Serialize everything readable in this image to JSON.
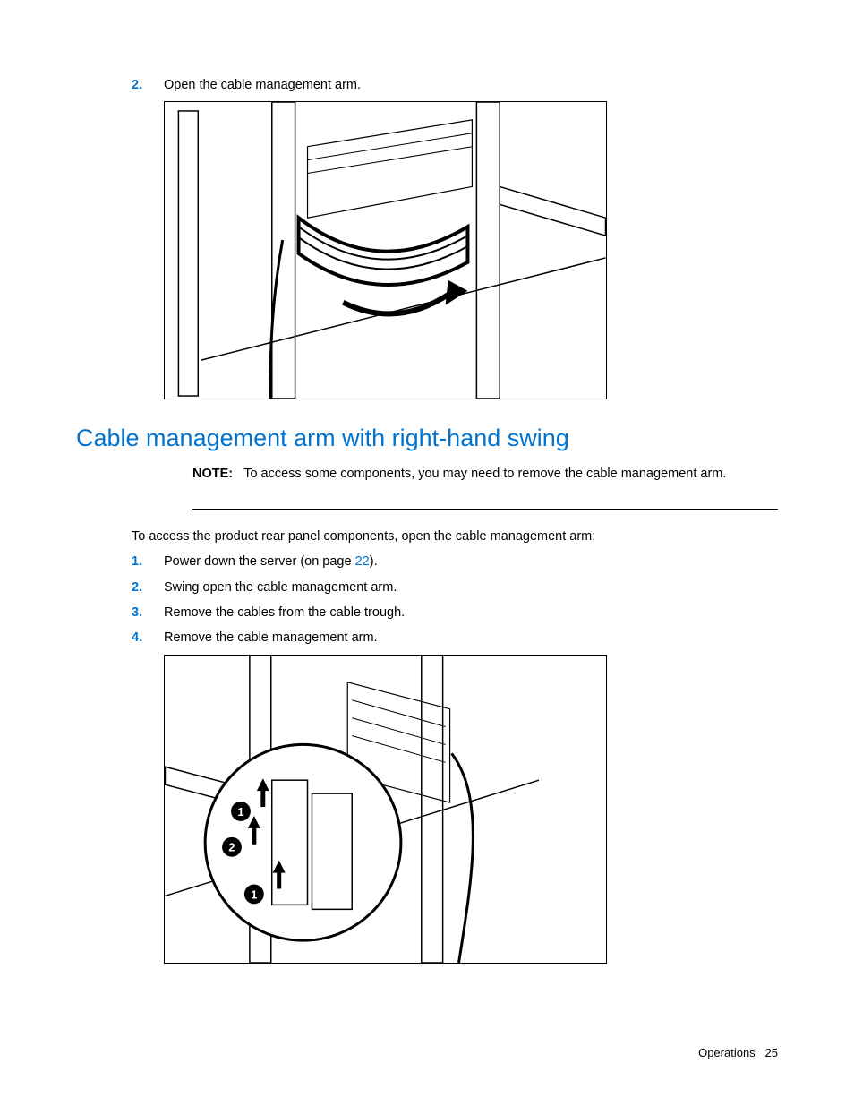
{
  "top_step": {
    "num": "2.",
    "text": "Open the cable management arm."
  },
  "heading": "Cable management arm with right-hand swing",
  "note": {
    "label": "NOTE:",
    "text": "To access some components, you may need to remove the cable management arm."
  },
  "intro": "To access the product rear panel components, open the cable management arm:",
  "steps": [
    {
      "num": "1.",
      "text_a": "Power down the server (on page ",
      "link": "22",
      "text_b": ")."
    },
    {
      "num": "2.",
      "text_a": "Swing open the cable management arm.",
      "link": "",
      "text_b": ""
    },
    {
      "num": "3.",
      "text_a": "Remove the cables from the cable trough.",
      "link": "",
      "text_b": ""
    },
    {
      "num": "4.",
      "text_a": "Remove the cable management arm.",
      "link": "",
      "text_b": ""
    }
  ],
  "footer": {
    "section": "Operations",
    "page": "25"
  }
}
